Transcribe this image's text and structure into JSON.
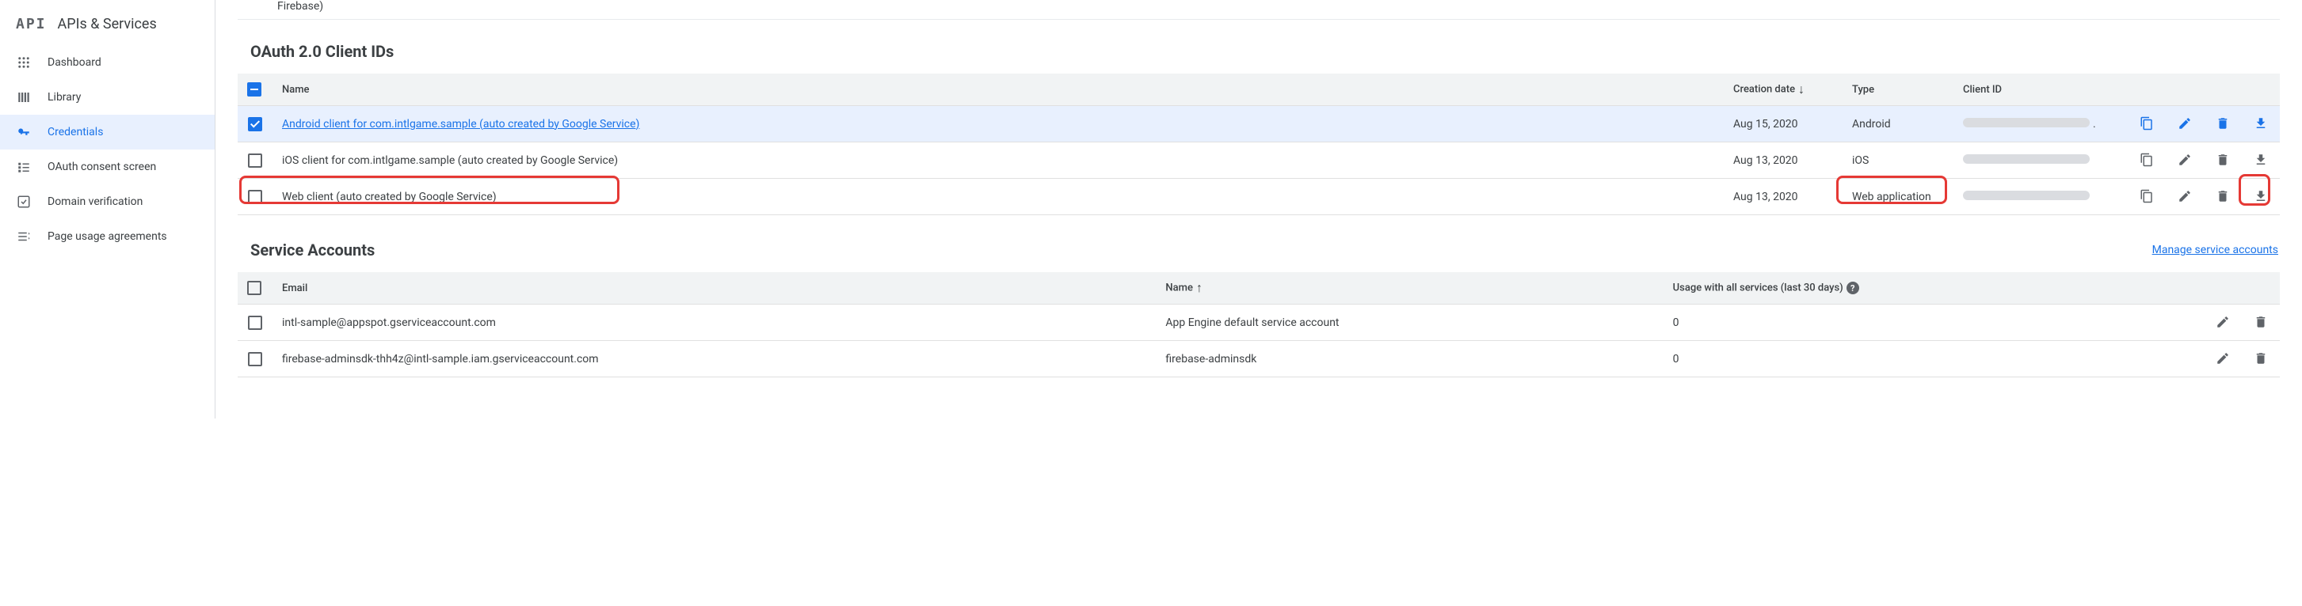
{
  "sidebar": {
    "logo_text": "API",
    "title": "APIs & Services",
    "items": [
      {
        "label": "Dashboard",
        "icon": "dashboard"
      },
      {
        "label": "Library",
        "icon": "library"
      },
      {
        "label": "Credentials",
        "icon": "key",
        "active": true
      },
      {
        "label": "OAuth consent screen",
        "icon": "consent"
      },
      {
        "label": "Domain verification",
        "icon": "check"
      },
      {
        "label": "Page usage agreements",
        "icon": "list"
      }
    ]
  },
  "partial_text": "Firebase)",
  "oauth_section": {
    "title": "OAuth 2.0 Client IDs",
    "headers": {
      "name": "Name",
      "creation_date": "Creation date",
      "type": "Type",
      "client_id": "Client ID"
    },
    "rows": [
      {
        "selected": true,
        "name": "Android client for com.intlgame.sample (auto created by Google Service)",
        "date": "Aug 15, 2020",
        "type": "Android",
        "link": true,
        "copy_primary": true
      },
      {
        "selected": false,
        "name": "iOS client for com.intlgame.sample (auto created by Google Service)",
        "date": "Aug 13, 2020",
        "type": "iOS"
      },
      {
        "selected": false,
        "name": "Web client (auto created by Google Service)",
        "date": "Aug 13, 2020",
        "type": "Web application",
        "highlight_name": true,
        "highlight_type": true,
        "highlight_download": true
      }
    ]
  },
  "service_section": {
    "title": "Service Accounts",
    "manage_link": "Manage service accounts",
    "headers": {
      "email": "Email",
      "name": "Name",
      "usage": "Usage with all services (last 30 days)"
    },
    "rows": [
      {
        "email": "intl-sample@appspot.gserviceaccount.com",
        "name": "App Engine default service account",
        "usage": "0"
      },
      {
        "email": "firebase-adminsdk-thh4z@intl-sample.iam.gserviceaccount.com",
        "name": "firebase-adminsdk",
        "usage": "0"
      }
    ]
  }
}
